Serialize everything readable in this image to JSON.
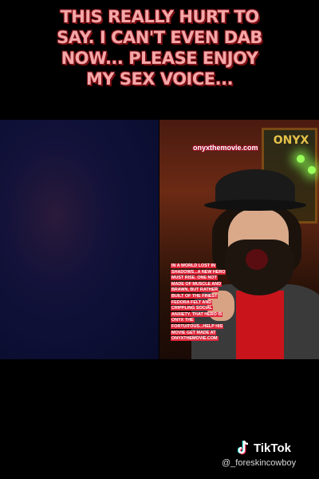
{
  "caption": {
    "lines": [
      "THIS REALLY HURT TO",
      "SAY. I CAN'T EVEN DAB",
      "NOW... PLEASE ENJOY",
      "MY SEX VOICE..."
    ],
    "color": "#f4a7a9"
  },
  "right_video": {
    "url_overlay": "onyxthemovie.com",
    "poster_text": "ONYX",
    "story_lines": [
      "IN A WORLD LOST IN",
      "SHADOWS...A NEW HERO",
      "MUST RISE. ONE NOT",
      "MADE OF MUSCLE AND",
      "BRAWN, BUT RATHER",
      "BUILT OF THE FINEST",
      "FEDORA FELT AND",
      "CRIPPLING SOCIAL",
      "ANXIETY. THAT HERO IS",
      "ONYX THE",
      "FORTUITOUS...HELP HIS",
      "MOVIE GET MADE AT",
      "ONYXTHEMOVIE.COM"
    ],
    "story_bg_color": "#e0263a"
  },
  "watermark": {
    "brand": "TikTok",
    "handle": "@_foreskincowboy",
    "icon": "tiktok-note-icon"
  }
}
